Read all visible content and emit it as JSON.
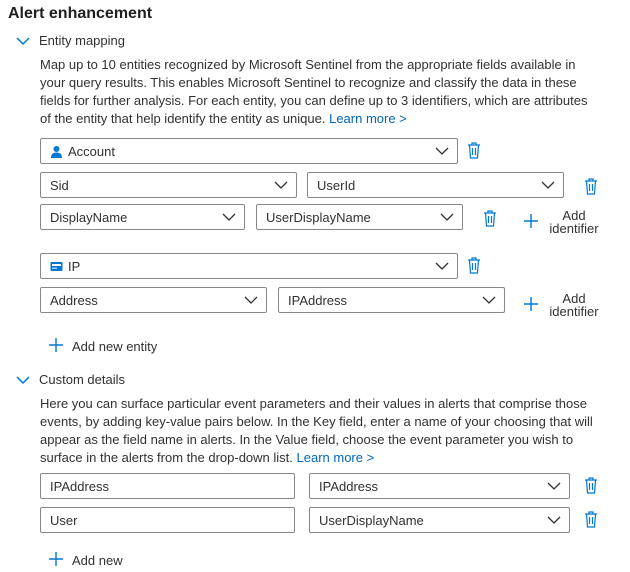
{
  "header": {
    "title": "Alert enhancement"
  },
  "entity_mapping": {
    "section_label": "Entity mapping",
    "description": "Map up to 10 entities recognized by Microsoft Sentinel from the appropriate fields available in your query results. This enables Microsoft Sentinel to recognize and classify the data in these fields for further analysis. For each entity, you can define up to 3 identifiers, which are attributes of the entity that help identify the entity as unique.",
    "learn_more": "Learn more >",
    "entities": [
      {
        "type": "Account",
        "icon": "user-icon",
        "identifiers": [
          {
            "identifier": "Sid",
            "column": "UserId"
          },
          {
            "identifier": "DisplayName",
            "column": "UserDisplayName"
          }
        ],
        "add_identifier": [
          "Add",
          "identifier"
        ]
      },
      {
        "type": "IP",
        "icon": "ip-address-icon",
        "identifiers": [
          {
            "identifier": "Address",
            "column": "IPAddress"
          }
        ],
        "add_identifier": [
          "Add",
          "identifier"
        ]
      }
    ],
    "add_new_entity": "Add new entity"
  },
  "custom_details": {
    "section_label": "Custom details",
    "description": "Here you can surface particular event parameters and their values in alerts that comprise those events, by adding key-value pairs below. In the Key field, enter a name of your choosing that will appear as the field name in alerts. In the Value field, choose the event parameter you wish to surface in the alerts from the drop-down list.",
    "learn_more": "Learn more >",
    "rows": [
      {
        "key": "IPAddress",
        "value": "IPAddress"
      },
      {
        "key": "User",
        "value": "UserDisplayName"
      }
    ],
    "add_new": "Add new"
  },
  "colors": {
    "accent": "#0078d4",
    "link": "#0067b8",
    "border": "#8a8886",
    "text": "#323130"
  }
}
